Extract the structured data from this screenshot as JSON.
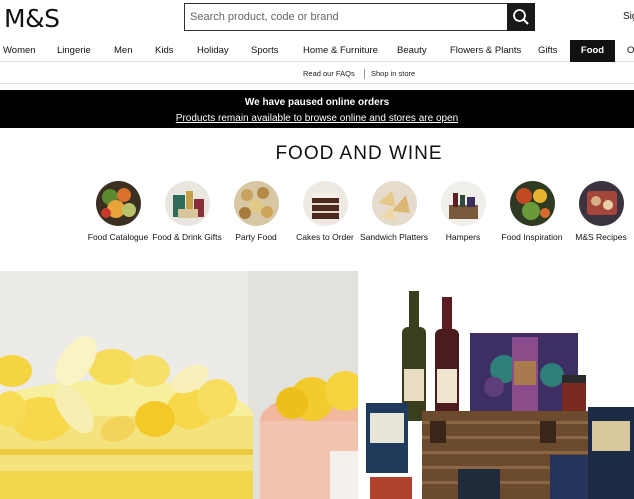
{
  "header": {
    "logo": "M&S",
    "search_placeholder": "Search product, code or brand",
    "signin": "Sign"
  },
  "nav": {
    "items": [
      "Women",
      "Lingerie",
      "Men",
      "Kids",
      "Holiday",
      "Sports",
      "Home & Furniture",
      "Beauty",
      "Flowers & Plants",
      "Gifts",
      "Food",
      "O"
    ],
    "active": "Food"
  },
  "subnav": {
    "faqs": "Read our FAQs",
    "shop_in_store": "Shop in store"
  },
  "banner": {
    "title": "We have paused online orders",
    "link": "Products remain available to browse online and stores are open"
  },
  "page_title": "FOOD AND WINE",
  "categories": [
    {
      "label": "Food Catalogue"
    },
    {
      "label": "Food & Drink Gifts"
    },
    {
      "label": "Party Food"
    },
    {
      "label": "Cakes to Order"
    },
    {
      "label": "Sandwich Platters"
    },
    {
      "label": "Hampers"
    },
    {
      "label": "Food Inspiration"
    },
    {
      "label": "M&S Recipes"
    }
  ],
  "icons": {
    "search": "search-icon"
  },
  "colors": {
    "black": "#000000",
    "cake_yellow": "#f2c319",
    "hamper_brown": "#6b4a2e"
  }
}
